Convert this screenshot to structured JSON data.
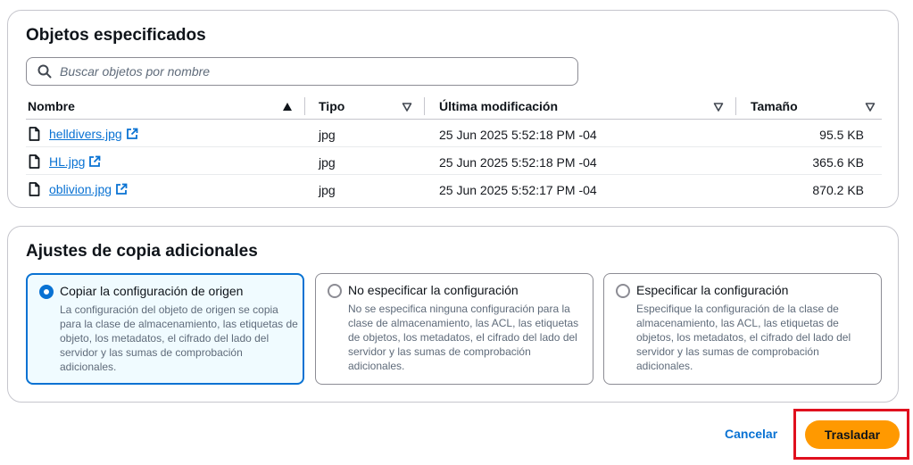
{
  "objects": {
    "title": "Objetos especificados",
    "search_placeholder": "Buscar objetos por nombre",
    "columns": {
      "name": "Nombre",
      "type": "Tipo",
      "modified": "Última modificación",
      "size": "Tamaño"
    },
    "rows": [
      {
        "name": "helldivers.jpg",
        "type": "jpg",
        "modified": "25 Jun 2025 5:52:18 PM -04",
        "size": "95.5 KB"
      },
      {
        "name": "HL.jpg",
        "type": "jpg",
        "modified": "25 Jun 2025 5:52:18 PM -04",
        "size": "365.6 KB"
      },
      {
        "name": "oblivion.jpg",
        "type": "jpg",
        "modified": "25 Jun 2025 5:52:17 PM -04",
        "size": "870.2 KB"
      }
    ]
  },
  "settings": {
    "title": "Ajustes de copia adicionales",
    "options": [
      {
        "label": "Copiar la configuración de origen",
        "description": "La configuración del objeto de origen se copia para la clase de almacenamiento, las etiquetas de objeto, los metadatos, el cifrado del lado del servidor y las sumas de comprobación adicionales.",
        "selected": true
      },
      {
        "label": "No especificar la configuración",
        "description": "No se especifica ninguna configuración para la clase de almacenamiento, las ACL, las etiquetas de objetos, los metadatos, el cifrado del lado del servidor y las sumas de comprobación adicionales.",
        "selected": false
      },
      {
        "label": "Especificar la configuración",
        "description": "Especifique la configuración de la clase de almacenamiento, las ACL, las etiquetas de objetos, los metadatos, el cifrado del lado del servidor y las sumas de comprobación adicionales.",
        "selected": false
      }
    ]
  },
  "actions": {
    "cancel_label": "Cancelar",
    "primary_label": "Trasladar"
  },
  "colors": {
    "accent": "#0972d3",
    "primary_button": "#ff9900",
    "highlight": "#e0101e"
  }
}
